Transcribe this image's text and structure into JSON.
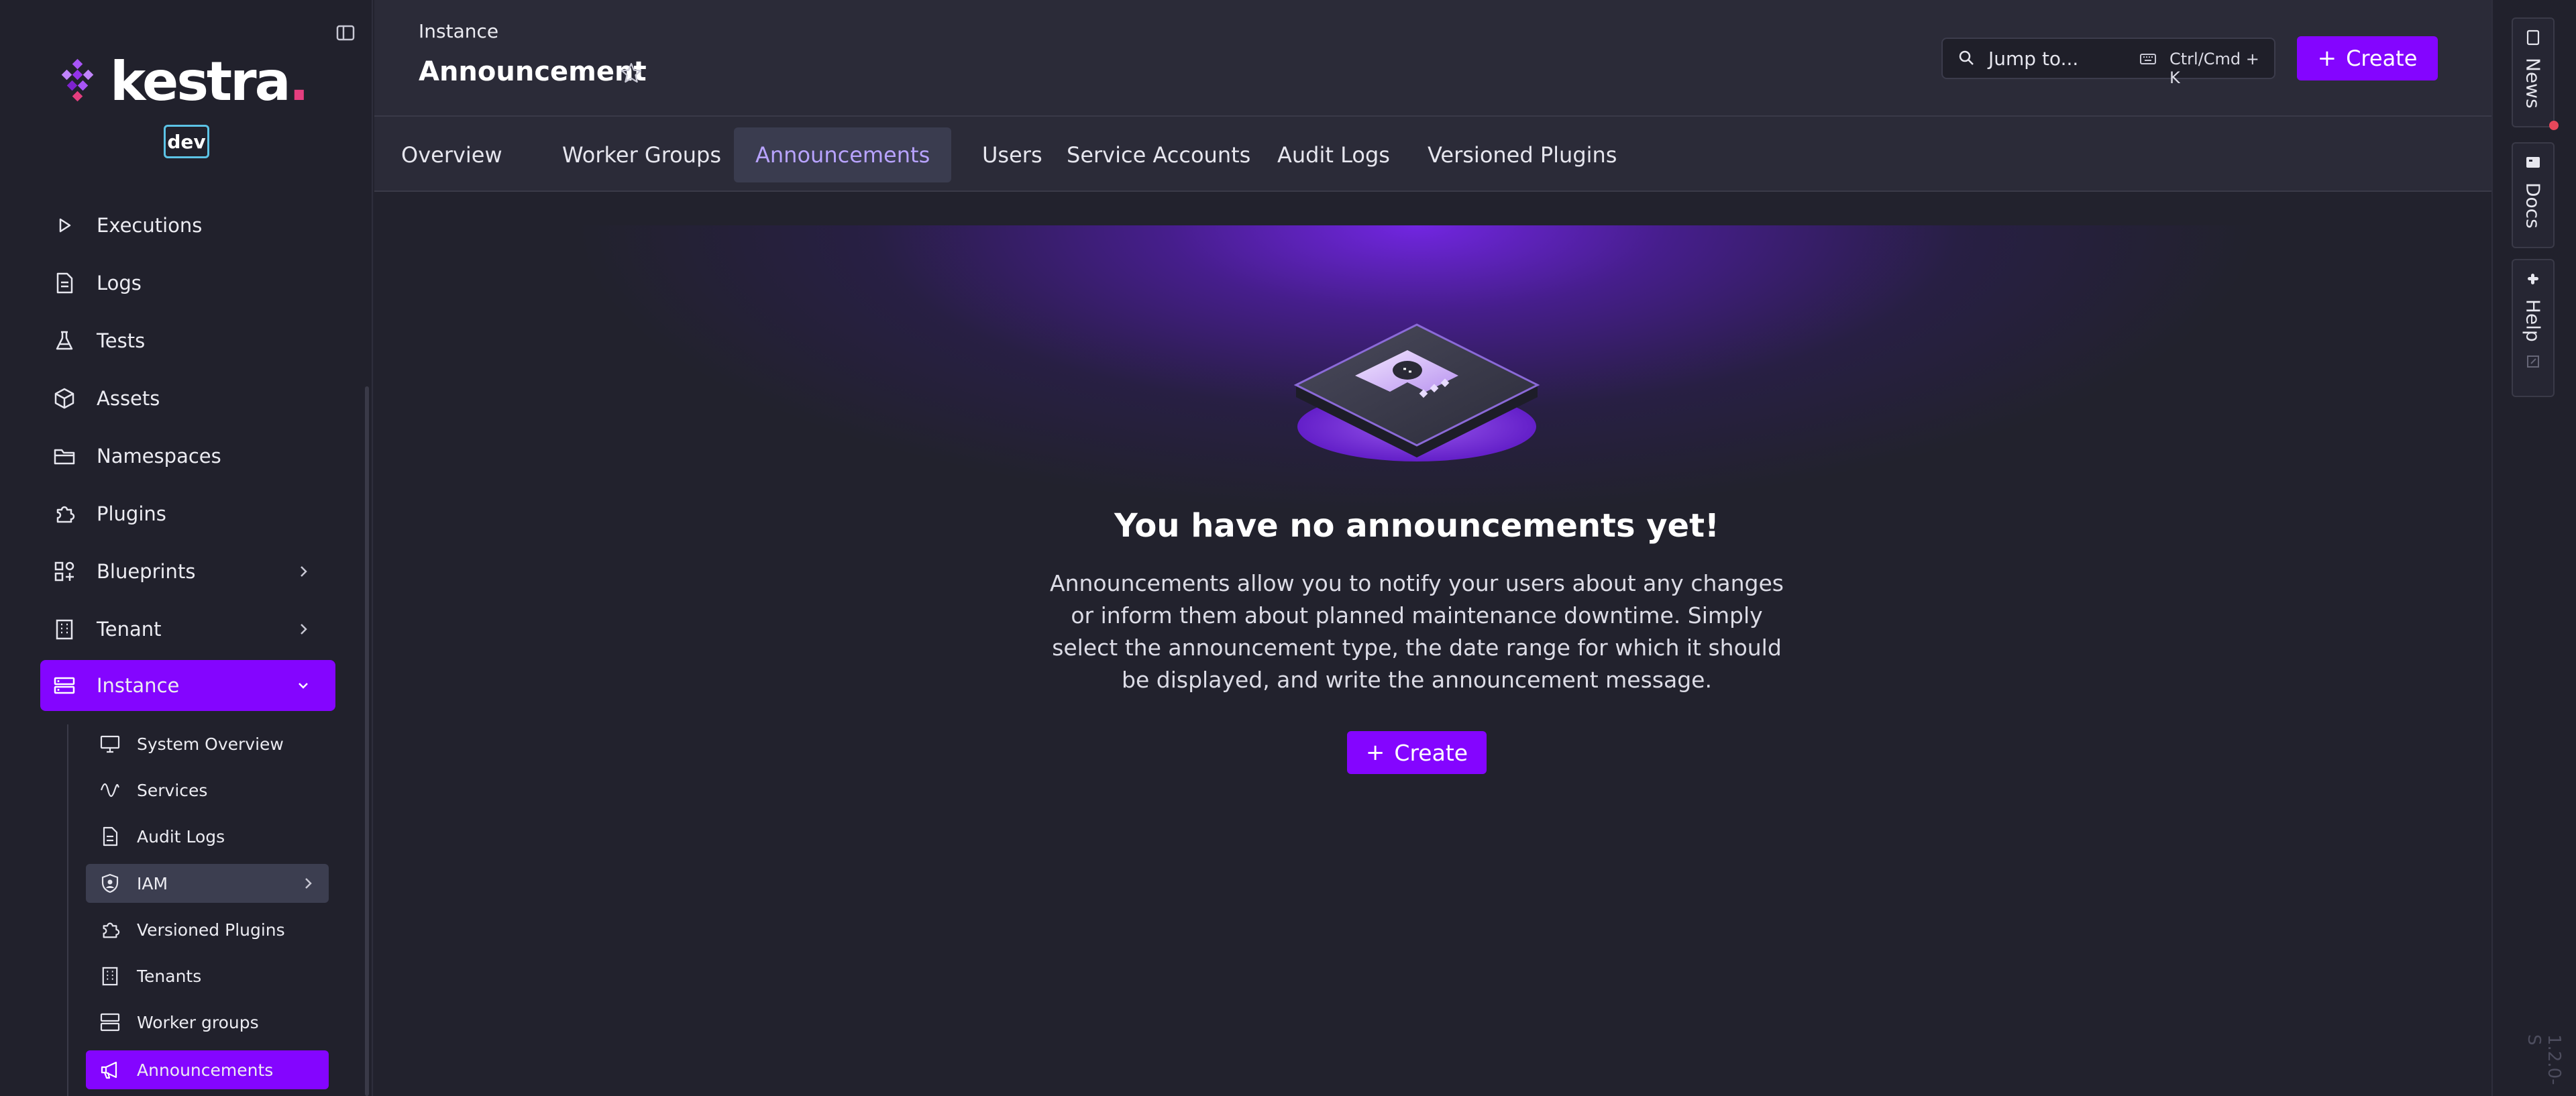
{
  "sidebar": {
    "logo_text": "kestra",
    "logo_dot": ".",
    "env_badge": "dev",
    "items": [
      {
        "label": "Executions",
        "icon": "play-icon"
      },
      {
        "label": "Logs",
        "icon": "file-text-icon"
      },
      {
        "label": "Tests",
        "icon": "flask-icon"
      },
      {
        "label": "Assets",
        "icon": "cube-icon"
      },
      {
        "label": "Namespaces",
        "icon": "folder-icon"
      },
      {
        "label": "Plugins",
        "icon": "puzzle-icon"
      },
      {
        "label": "Blueprints",
        "icon": "shapes-icon"
      },
      {
        "label": "Tenant",
        "icon": "building-icon"
      },
      {
        "label": "Instance",
        "icon": "server-icon"
      }
    ],
    "sub_items": [
      {
        "label": "System Overview",
        "icon": "monitor-icon"
      },
      {
        "label": "Services",
        "icon": "pulse-icon"
      },
      {
        "label": "Audit Logs",
        "icon": "file-text-icon"
      },
      {
        "label": "IAM",
        "icon": "shield-icon"
      },
      {
        "label": "Versioned Plugins",
        "icon": "puzzle-icon"
      },
      {
        "label": "Tenants",
        "icon": "building-icon"
      },
      {
        "label": "Worker groups",
        "icon": "server-stack-icon"
      },
      {
        "label": "Announcements",
        "icon": "megaphone-icon"
      }
    ]
  },
  "header": {
    "breadcrumb": "Instance",
    "title": "Announcement",
    "search_placeholder": "Jump to...",
    "search_shortcut": "Ctrl/Cmd + K",
    "create_label": "Create",
    "create_icon": "+"
  },
  "tabs": [
    {
      "label": "Overview"
    },
    {
      "label": "Worker Groups"
    },
    {
      "label": "Announcements"
    },
    {
      "label": "Users"
    },
    {
      "label": "Service Accounts"
    },
    {
      "label": "Audit Logs"
    },
    {
      "label": "Versioned Plugins"
    }
  ],
  "main": {
    "empty_title": "You have no announcements yet!",
    "empty_desc": "Announcements allow you to notify your users about any changes or inform them about planned maintenance downtime. Simply select the announcement type, the date range for which it should be displayed, and write the announcement message.",
    "create_label": "Create",
    "create_icon": "+"
  },
  "rail": {
    "news": "News",
    "docs": "Docs",
    "help": "Help",
    "version": "1.2.0-S"
  },
  "colors": {
    "accent": "#8405ff",
    "background": "#23232e",
    "sidebar": "#21212c",
    "tab_active_text": "#b8a3ff",
    "notification_dot": "#e5475a"
  }
}
